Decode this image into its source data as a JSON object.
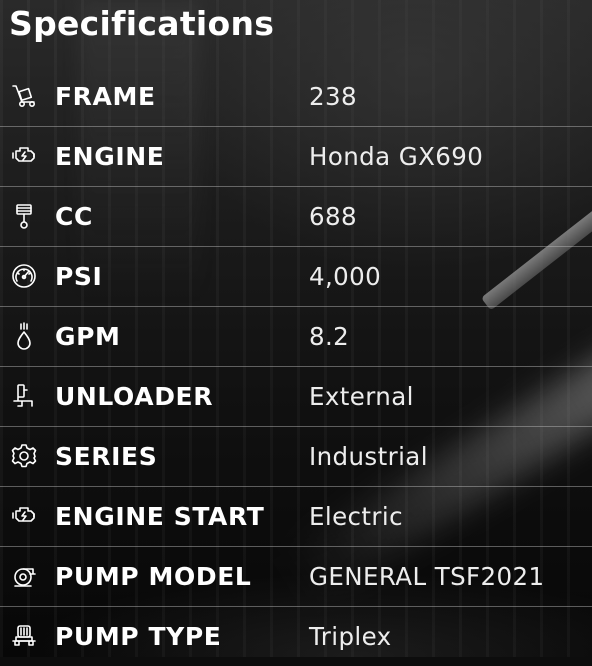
{
  "title": "Specifications",
  "specs": [
    {
      "icon": "hand-truck-icon",
      "label": "FRAME",
      "value": "238"
    },
    {
      "icon": "engine-icon",
      "label": "ENGINE",
      "value": "Honda GX690"
    },
    {
      "icon": "piston-icon",
      "label": "CC",
      "value": "688"
    },
    {
      "icon": "gauge-icon",
      "label": "PSI",
      "value": "4,000"
    },
    {
      "icon": "water-drop-icon",
      "label": "GPM",
      "value": "8.2"
    },
    {
      "icon": "unloader-valve-icon",
      "label": "UNLOADER",
      "value": "External"
    },
    {
      "icon": "gear-icon",
      "label": "SERIES",
      "value": "Industrial"
    },
    {
      "icon": "engine-icon",
      "label": "ENGINE START",
      "value": "Electric"
    },
    {
      "icon": "pump-icon",
      "label": "PUMP MODEL",
      "value": "GENERAL TSF2021"
    },
    {
      "icon": "triplex-pump-icon",
      "label": "PUMP TYPE",
      "value": "Triplex"
    }
  ]
}
